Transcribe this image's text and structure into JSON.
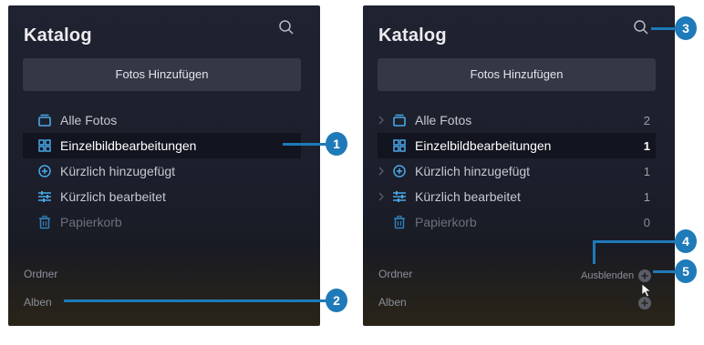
{
  "catalog": {
    "title": "Katalog",
    "add_photos_label": "Fotos Hinzufügen",
    "items": [
      {
        "label": "Alle Fotos",
        "icon": "stack-icon",
        "count": "2"
      },
      {
        "label": "Einzelbildbearbeitungen",
        "icon": "grid-icon",
        "count": "1"
      },
      {
        "label": "Kürzlich hinzugefügt",
        "icon": "plus-circle-icon",
        "count": "1"
      },
      {
        "label": "Kürzlich bearbeitet",
        "icon": "sliders-icon",
        "count": "1"
      },
      {
        "label": "Papierkorb",
        "icon": "trash-icon",
        "count": "0"
      }
    ],
    "folders_label": "Ordner",
    "albums_label": "Alben",
    "hide_label": "Ausblenden"
  },
  "callouts": [
    "1",
    "2",
    "3",
    "4",
    "5"
  ],
  "colors": {
    "panel_bg": "#1f2230",
    "button_bg": "#343745",
    "selected_row": "#121520",
    "accent_icon": "#4aa8e8",
    "callout": "#1e7ab8"
  }
}
